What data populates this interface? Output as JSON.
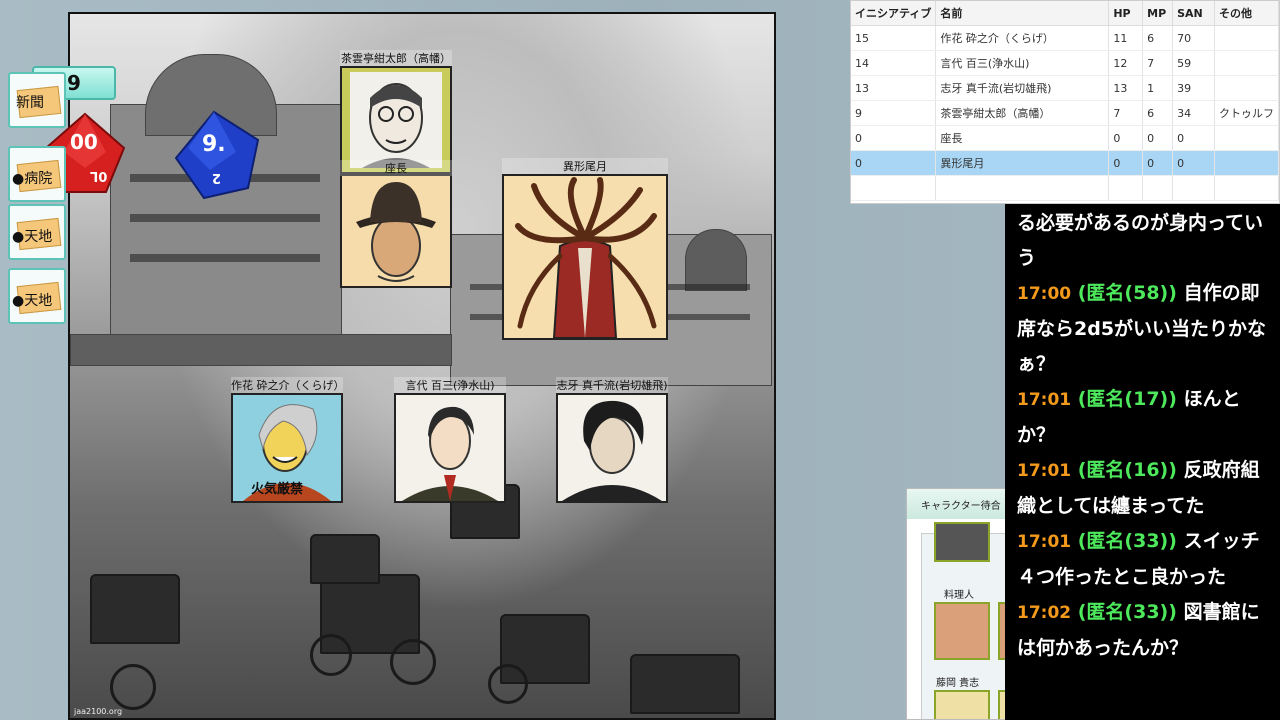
{
  "dice_counter": "9",
  "dice": {
    "red": "00",
    "red_alt": "0L",
    "blue": "9.",
    "blue_alt": "2"
  },
  "side_buttons": [
    {
      "label": "新聞"
    },
    {
      "label": "●病院"
    },
    {
      "label": "●天地"
    },
    {
      "label": "●天地"
    }
  ],
  "map": {
    "credit": "jaa2100.org"
  },
  "tokens": [
    {
      "name": "茶雲亭紺太郎（高幡）"
    },
    {
      "name": "座長"
    },
    {
      "name": "異形尾月"
    },
    {
      "name": "作花 砕之介（くらげ）",
      "shirt_text": "火気厳禁"
    },
    {
      "name": "言代 百三(浄水山)"
    },
    {
      "name": "志牙 真千流(岩切雄飛)"
    }
  ],
  "table": {
    "headers": [
      "イニシアティブ",
      "名前",
      "HP",
      "MP",
      "SAN",
      "その他"
    ],
    "rows": [
      {
        "init": "15",
        "name": "作花 砕之介（くらげ）",
        "hp": "11",
        "mp": "6",
        "san": "70",
        "other": ""
      },
      {
        "init": "14",
        "name": "言代 百三(浄水山)",
        "hp": "12",
        "mp": "7",
        "san": "59",
        "other": ""
      },
      {
        "init": "13",
        "name": "志牙 真千流(岩切雄飛)",
        "hp": "13",
        "mp": "1",
        "san": "39",
        "other": ""
      },
      {
        "init": "9",
        "name": "茶雲亭紺太郎（高幡）",
        "hp": "7",
        "mp": "6",
        "san": "34",
        "other": "クトゥルフ"
      },
      {
        "init": "0",
        "name": "座長",
        "hp": "0",
        "mp": "0",
        "san": "0",
        "other": ""
      },
      {
        "init": "0",
        "name": "異形尾月",
        "hp": "0",
        "mp": "0",
        "san": "0",
        "other": "",
        "selected": true
      }
    ]
  },
  "chat": {
    "lines": [
      {
        "time": "",
        "name": "",
        "text": "る必要があるのが身内っていう"
      },
      {
        "time": "17:00",
        "name": "(匿名(58))",
        "text": "自作の即席なら2d5がいい当たりかなぁ？"
      },
      {
        "time": "17:01",
        "name": "(匿名(17))",
        "text": "ほんとか？"
      },
      {
        "time": "17:01",
        "name": "(匿名(16))",
        "text": "反政府組織としては纏まってた"
      },
      {
        "time": "17:01",
        "name": "(匿名(33))",
        "text": "スイッチ４つ作ったとこ良かった"
      },
      {
        "time": "17:02",
        "name": "(匿名(33))",
        "text": "図書館には何かあったんか？"
      }
    ]
  },
  "palette": {
    "title": "キャラクター待合",
    "labels": [
      "料理人",
      "藤岡 貴志"
    ]
  },
  "colors": {
    "chat_time": "#f39a1c",
    "chat_name": "#4de85b",
    "selected_row": "#a9d6f5",
    "accent": "#5cc3b6"
  }
}
